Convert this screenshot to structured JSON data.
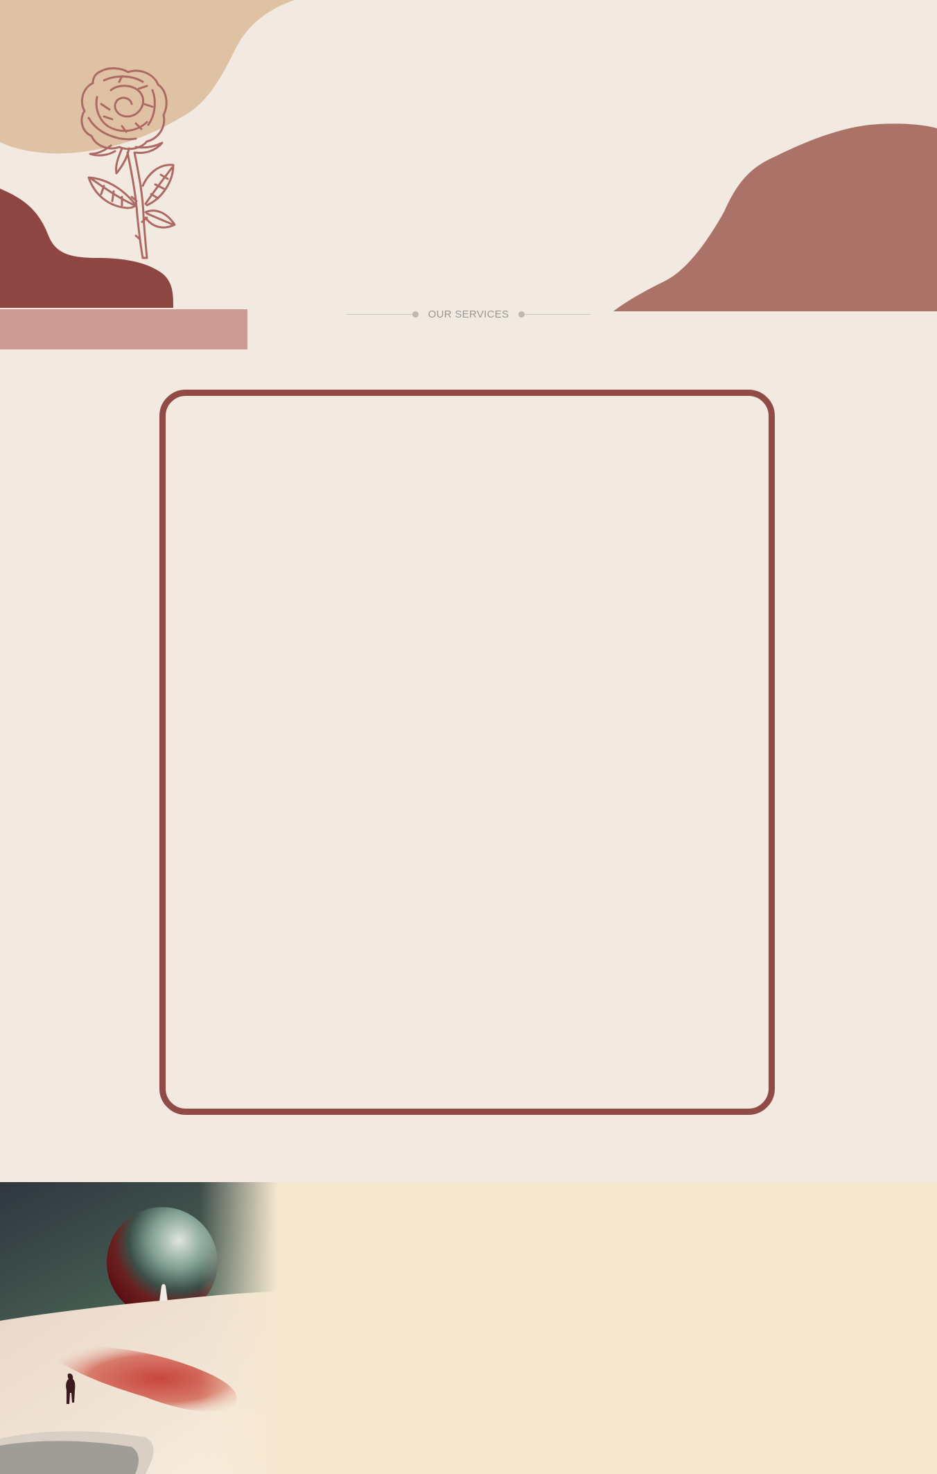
{
  "section": {
    "heading": "OUR SERVICES"
  },
  "colors": {
    "background": "#f2e9e0",
    "tan_blob": "#dfc1a3",
    "dark_red_hill": "#8e4643",
    "pink_bar": "#cf9b96",
    "right_hill": "#ab7268",
    "rose_outline": "#ad6a65",
    "frame_border": "#914b47",
    "bottom_band": "#f6e7cf"
  },
  "icons": {
    "rose": "rose-icon",
    "heading_dot": "dot-icon"
  }
}
